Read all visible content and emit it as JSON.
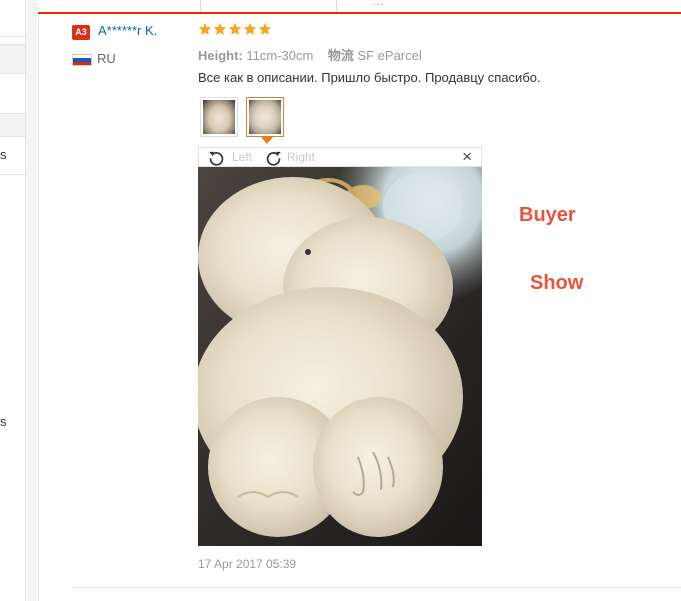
{
  "sidebar": {
    "label_1": "s",
    "label_2": "s"
  },
  "top_tab": {
    "label": "…"
  },
  "review": {
    "level_badge": "A3",
    "username": "A******r K.",
    "country": "RU",
    "rating": 5,
    "attributes": {
      "height_key": "Height:",
      "height_value": "11cm-30cm",
      "shipping_key": "物流",
      "shipping_value": "SF eParcel"
    },
    "feedback": "Все как в описании. Пришло быстро. Продавцу спасибо.",
    "date": "17 Apr 2017 05:39"
  },
  "viewer": {
    "rotate_left_label": "Left",
    "rotate_right_label": "Right",
    "close_label": "×"
  },
  "overlay": {
    "line_1": "Buyer",
    "line_2": "Show"
  },
  "colors": {
    "accent": "#e62e04",
    "username": "#0a63b5",
    "badge": "#d9311e",
    "star": "#f5a623",
    "overlay_text": "#e8543c",
    "thumb_active_border": "#e67e22"
  }
}
